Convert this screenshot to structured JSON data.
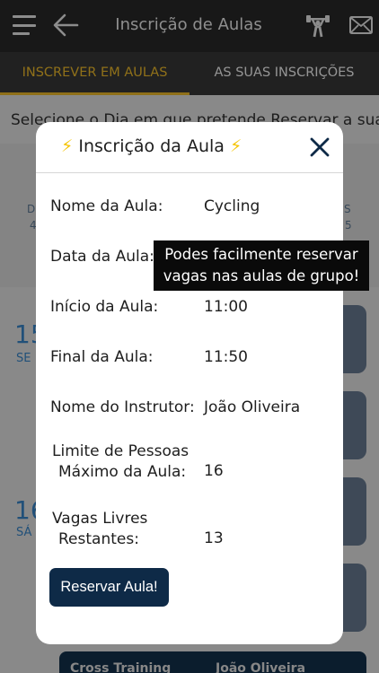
{
  "header": {
    "title": "Inscrição de Aulas",
    "icons": [
      "menu-icon",
      "back-arrow-icon",
      "dumbbell-icon",
      "mail-icon"
    ]
  },
  "tabs": [
    {
      "label": "INSCREVER EM AULAS",
      "active": true
    },
    {
      "label": "AS SUAS INSCRIÇÕES",
      "active": false
    }
  ],
  "background": {
    "instruction": "Selecione o Dia em que pretende Reservar a sua",
    "day_fragments": [
      "D",
      "4",
      "S",
      "5"
    ],
    "dates": [
      {
        "day": "15",
        "weekday": "SE"
      },
      {
        "day": "16",
        "weekday": "SÁ"
      }
    ],
    "bottom_card": {
      "class_name": "Cross Training",
      "instructor": "João Oliveira"
    }
  },
  "modal": {
    "title_icon_left": "⚡",
    "title": "Inscrição da Aula",
    "title_icon_right": "⚡",
    "fields": {
      "class_name": {
        "label": "Nome da Aula:",
        "value": "Cycling"
      },
      "class_date": {
        "label": "Data da Aula:"
      },
      "start_time": {
        "label": "Início da Aula:",
        "value": "11:00"
      },
      "end_time": {
        "label": "Final da Aula:",
        "value": "11:50"
      },
      "instructor": {
        "label": "Nome do Instrutor:",
        "value": "João Oliveira"
      },
      "max_people": {
        "label_line1": "Limite de Pessoas",
        "label_line2": "Máximo da Aula:",
        "value": "16"
      },
      "free_spots": {
        "label_line1": "Vagas Livres",
        "label_line2": "Restantes:",
        "value": "13"
      }
    },
    "reserve_button": "Reservar Aula!"
  },
  "tooltip": {
    "line1": "Podes facilmente reservar",
    "line2": "vagas nas aulas de grupo!"
  },
  "colors": {
    "accent": "#f7c22c",
    "primary_dark": "#0e2a47",
    "header_bg": "#2a2a2a",
    "date_blue": "#3a8ad0"
  }
}
